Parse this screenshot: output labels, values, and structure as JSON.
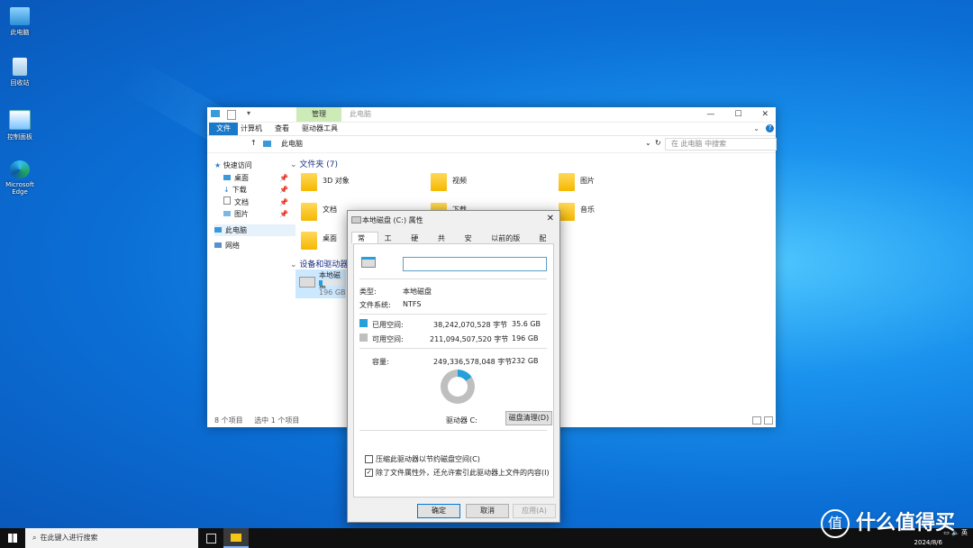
{
  "desktop": {
    "icons": [
      {
        "label": "此电脑"
      },
      {
        "label": "回收站"
      },
      {
        "label": "控制面板"
      },
      {
        "label": "Microsoft Edge"
      }
    ]
  },
  "explorer": {
    "ribbon_context_tab": "管理",
    "title": "此电脑",
    "tabs": [
      "文件",
      "计算机",
      "查看",
      "驱动器工具"
    ],
    "address": "此电脑",
    "search_placeholder": "在 此电脑 中搜索",
    "nav": {
      "quick_access": "快速访问",
      "items": [
        "桌面",
        "下载",
        "文档",
        "图片"
      ],
      "this_pc": "此电脑",
      "network": "网络"
    },
    "folders_group": "文件夹 (7)",
    "folders": [
      "3D 对象",
      "视频",
      "图片",
      "文档",
      "下载",
      "音乐",
      "桌面"
    ],
    "devices_group": "设备和驱动器",
    "drive": {
      "name": "本地磁盘",
      "size_text": "196 GB"
    },
    "status_items": "8 个项目",
    "status_selected": "选中 1 个项目"
  },
  "dialog": {
    "title": "本地磁盘 (C:) 属性",
    "tabs": [
      "常规",
      "工具",
      "硬件",
      "共享",
      "安全",
      "以前的版本",
      "配额"
    ],
    "type_label": "类型:",
    "type_value": "本地磁盘",
    "fs_label": "文件系统:",
    "fs_value": "NTFS",
    "used_label": "已用空间:",
    "used_bytes": "38,242,070,528 字节",
    "used_size": "35.6 GB",
    "free_label": "可用空间:",
    "free_bytes": "211,094,507,520 字节",
    "free_size": "196 GB",
    "capacity_label": "容量:",
    "capacity_bytes": "249,336,578,048 字节",
    "capacity_size": "232 GB",
    "drive_label": "驱动器 C:",
    "cleanup_button": "磁盘清理(D)",
    "compress_label": "压缩此驱动器以节约磁盘空间(C)",
    "index_label": "除了文件属性外，还允许索引此驱动器上文件的内容(I)",
    "ok": "确定",
    "cancel": "取消",
    "apply": "应用(A)",
    "used_fraction": 0.153,
    "colors": {
      "used": "#26a0da",
      "free": "#bfbfbf"
    }
  },
  "taskbar": {
    "search_placeholder": "在此键入进行搜索",
    "ime": "英",
    "date": "2024/8/6"
  },
  "watermark": "什么值得买"
}
